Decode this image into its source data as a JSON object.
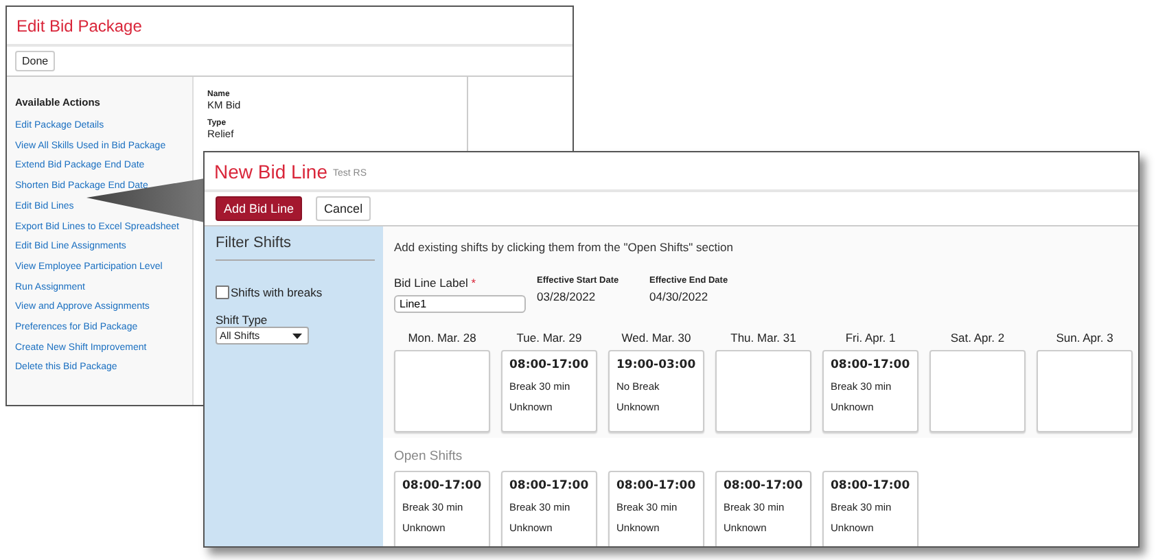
{
  "back_window": {
    "title": "Edit Bid Package",
    "buttons": [
      "Done"
    ],
    "actions_heading": "Available Actions",
    "actions": [
      "Edit Package Details",
      "View All Skills Used in Bid Package",
      "Extend Bid Package End Date",
      "Shorten Bid Package End Date",
      "Edit Bid Lines",
      "Export Bid Lines to Excel Spreadsheet",
      "Edit Bid Line Assignments",
      "View Employee Participation Level",
      "Run Assignment",
      "View and Approve Assignments",
      "Preferences for Bid Package",
      "Create New Shift Improvement",
      "Delete this Bid Package"
    ],
    "details": [
      {
        "label": "Name",
        "value": "KM Bid"
      },
      {
        "label": "Type",
        "value": "Relief"
      }
    ]
  },
  "front_window": {
    "title": "New Bid Line",
    "subtitle": "Test RS",
    "buttons": [
      {
        "label": "Add Bid Line",
        "kind": "primary"
      },
      {
        "label": "Cancel",
        "kind": "secondary"
      }
    ],
    "filter": {
      "heading": "Filter Shifts",
      "checkbox": {
        "label": "Shifts with breaks",
        "checked": false
      },
      "shift_type_label": "Shift Type",
      "shift_type_value": "All Shifts"
    },
    "instruction": "Add existing shifts by clicking them from the \"Open Shifts\" section",
    "label_field": {
      "label": "Bid Line Label",
      "required_mark": "*",
      "value": "Line1"
    },
    "dates": [
      {
        "label": "Effective Start Date",
        "value": "03/28/2022"
      },
      {
        "label": "Effective End Date",
        "value": "04/30/2022"
      }
    ],
    "days": [
      {
        "label": "Mon. Mar. 28"
      },
      {
        "label": "Tue. Mar. 29",
        "shift": {
          "time": "08:00-17:00",
          "break": "Break 30 min",
          "status": "Unknown"
        }
      },
      {
        "label": "Wed. Mar. 30",
        "shift": {
          "time": "19:00-03:00",
          "break": "No Break",
          "status": "Unknown"
        }
      },
      {
        "label": "Thu. Mar. 31"
      },
      {
        "label": "Fri. Apr. 1",
        "shift": {
          "time": "08:00-17:00",
          "break": "Break 30 min",
          "status": "Unknown"
        }
      },
      {
        "label": "Sat. Apr. 2"
      },
      {
        "label": "Sun. Apr. 3"
      }
    ],
    "open_shifts_heading": "Open Shifts",
    "open_shifts": [
      {
        "time": "08:00-17:00",
        "break": "Break 30 min",
        "status": "Unknown"
      },
      {
        "time": "08:00-17:00",
        "break": "Break 30 min",
        "status": "Unknown"
      },
      {
        "time": "08:00-17:00",
        "break": "Break 30 min",
        "status": "Unknown"
      },
      {
        "time": "08:00-17:00",
        "break": "Break 30 min",
        "status": "Unknown"
      },
      {
        "time": "08:00-17:00",
        "break": "Break 30 min",
        "status": "Unknown"
      }
    ]
  }
}
